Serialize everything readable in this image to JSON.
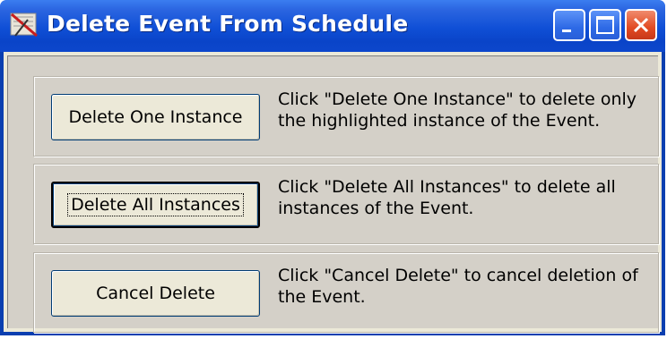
{
  "window": {
    "title": "Delete Event From Schedule",
    "controls": {
      "minimize_icon": "minimize-icon",
      "maximize_icon": "maximize-icon",
      "close_icon": "close-icon"
    },
    "colors": {
      "titlebar": "#0a44c8",
      "client": "#d4d0c8",
      "button_face": "#ece9d8"
    }
  },
  "options": [
    {
      "button_label": "Delete One Instance",
      "description": "Click \"Delete One Instance\" to delete only the highlighted instance of the Event."
    },
    {
      "button_label": "Delete All Instances",
      "description": "Click \"Delete All Instances\" to delete all instances of the Event."
    },
    {
      "button_label": "Cancel Delete",
      "description": "Click \"Cancel Delete\" to cancel deletion of the Event."
    }
  ]
}
